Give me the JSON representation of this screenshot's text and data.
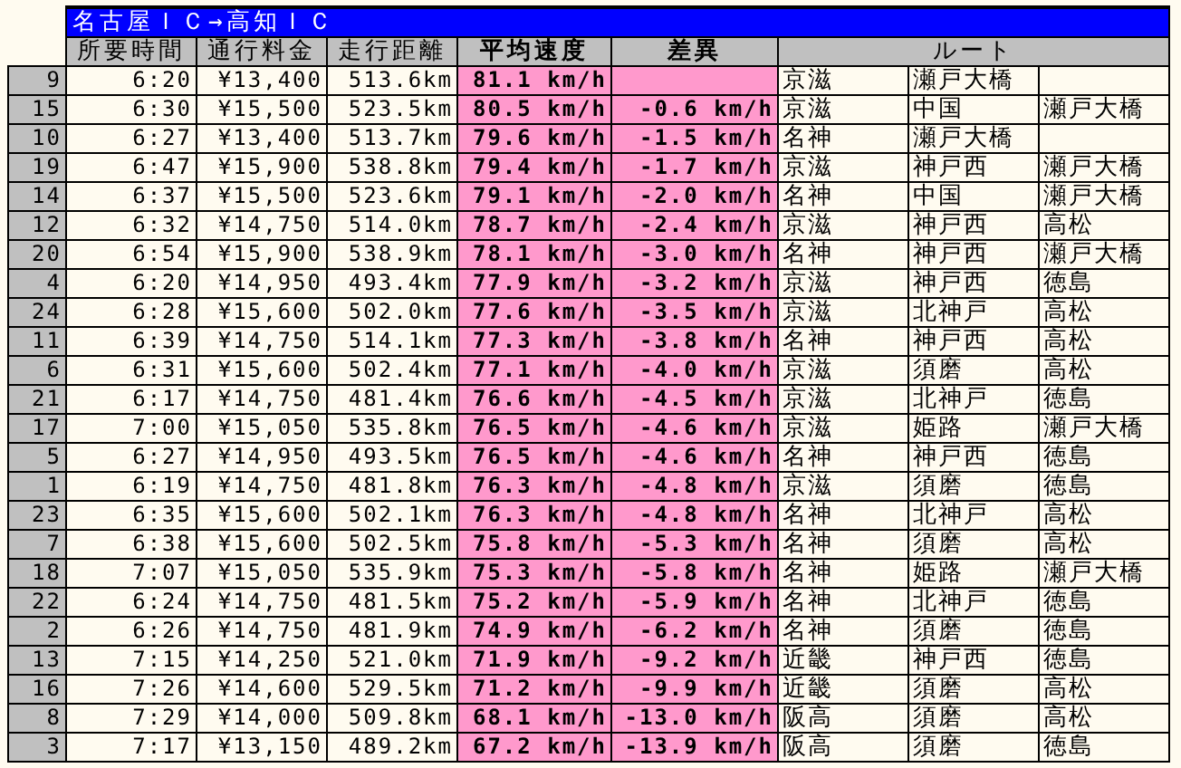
{
  "table": {
    "title": "名古屋ＩＣ→高知ＩＣ",
    "columns": [
      {
        "label": "所要時間",
        "bold": false
      },
      {
        "label": "通行料金",
        "bold": false
      },
      {
        "label": "走行距離",
        "bold": false
      },
      {
        "label": "平均速度",
        "bold": true
      },
      {
        "label": "差異",
        "bold": true
      },
      {
        "label": "ルート",
        "bold": false
      }
    ],
    "rows": [
      {
        "no": "9",
        "time": "6:20",
        "toll": "¥13,400",
        "distance": "513.6km",
        "speed": "81.1 km/h",
        "route": [
          "京滋",
          "瀬戸大橋"
        ]
      },
      {
        "no": "15",
        "time": "6:30",
        "toll": "¥15,500",
        "distance": "523.5km",
        "speed": "80.5 km/h",
        "difference": "-0.6 km/h",
        "route": [
          "京滋",
          "中国",
          "瀬戸大橋"
        ]
      },
      {
        "no": "10",
        "time": "6:27",
        "toll": "¥13,400",
        "distance": "513.7km",
        "speed": "79.6 km/h",
        "difference": "-1.5 km/h",
        "route": [
          "名神",
          "瀬戸大橋"
        ]
      },
      {
        "no": "19",
        "time": "6:47",
        "toll": "¥15,900",
        "distance": "538.8km",
        "speed": "79.4 km/h",
        "difference": "-1.7 km/h",
        "route": [
          "京滋",
          "神戸西",
          "瀬戸大橋"
        ]
      },
      {
        "no": "14",
        "time": "6:37",
        "toll": "¥15,500",
        "distance": "523.6km",
        "speed": "79.1 km/h",
        "difference": "-2.0 km/h",
        "route": [
          "名神",
          "中国",
          "瀬戸大橋"
        ]
      },
      {
        "no": "12",
        "time": "6:32",
        "toll": "¥14,750",
        "distance": "514.0km",
        "speed": "78.7 km/h",
        "difference": "-2.4 km/h",
        "route": [
          "京滋",
          "神戸西",
          "高松"
        ]
      },
      {
        "no": "20",
        "time": "6:54",
        "toll": "¥15,900",
        "distance": "538.9km",
        "speed": "78.1 km/h",
        "difference": "-3.0 km/h",
        "route": [
          "名神",
          "神戸西",
          "瀬戸大橋"
        ]
      },
      {
        "no": "4",
        "time": "6:20",
        "toll": "¥14,950",
        "distance": "493.4km",
        "speed": "77.9 km/h",
        "difference": "-3.2 km/h",
        "route": [
          "京滋",
          "神戸西",
          "徳島"
        ]
      },
      {
        "no": "24",
        "time": "6:28",
        "toll": "¥15,600",
        "distance": "502.0km",
        "speed": "77.6 km/h",
        "difference": "-3.5 km/h",
        "route": [
          "京滋",
          "北神戸",
          "高松"
        ]
      },
      {
        "no": "11",
        "time": "6:39",
        "toll": "¥14,750",
        "distance": "514.1km",
        "speed": "77.3 km/h",
        "difference": "-3.8 km/h",
        "route": [
          "名神",
          "神戸西",
          "高松"
        ]
      },
      {
        "no": "6",
        "time": "6:31",
        "toll": "¥15,600",
        "distance": "502.4km",
        "speed": "77.1 km/h",
        "difference": "-4.0 km/h",
        "route": [
          "京滋",
          "須磨",
          "高松"
        ]
      },
      {
        "no": "21",
        "time": "6:17",
        "toll": "¥14,750",
        "distance": "481.4km",
        "speed": "76.6 km/h",
        "difference": "-4.5 km/h",
        "route": [
          "京滋",
          "北神戸",
          "徳島"
        ]
      },
      {
        "no": "17",
        "time": "7:00",
        "toll": "¥15,050",
        "distance": "535.8km",
        "speed": "76.5 km/h",
        "difference": "-4.6 km/h",
        "route": [
          "京滋",
          "姫路",
          "瀬戸大橋"
        ]
      },
      {
        "no": "5",
        "time": "6:27",
        "toll": "¥14,950",
        "distance": "493.5km",
        "speed": "76.5 km/h",
        "difference": "-4.6 km/h",
        "route": [
          "名神",
          "神戸西",
          "徳島"
        ]
      },
      {
        "no": "1",
        "time": "6:19",
        "toll": "¥14,750",
        "distance": "481.8km",
        "speed": "76.3 km/h",
        "difference": "-4.8 km/h",
        "route": [
          "京滋",
          "須磨",
          "徳島"
        ]
      },
      {
        "no": "23",
        "time": "6:35",
        "toll": "¥15,600",
        "distance": "502.1km",
        "speed": "76.3 km/h",
        "difference": "-4.8 km/h",
        "route": [
          "名神",
          "北神戸",
          "高松"
        ]
      },
      {
        "no": "7",
        "time": "6:38",
        "toll": "¥15,600",
        "distance": "502.5km",
        "speed": "75.8 km/h",
        "difference": "-5.3 km/h",
        "route": [
          "名神",
          "須磨",
          "高松"
        ]
      },
      {
        "no": "18",
        "time": "7:07",
        "toll": "¥15,050",
        "distance": "535.9km",
        "speed": "75.3 km/h",
        "difference": "-5.8 km/h",
        "route": [
          "名神",
          "姫路",
          "瀬戸大橋"
        ]
      },
      {
        "no": "22",
        "time": "6:24",
        "toll": "¥14,750",
        "distance": "481.5km",
        "speed": "75.2 km/h",
        "difference": "-5.9 km/h",
        "route": [
          "名神",
          "北神戸",
          "徳島"
        ]
      },
      {
        "no": "2",
        "time": "6:26",
        "toll": "¥14,750",
        "distance": "481.9km",
        "speed": "74.9 km/h",
        "difference": "-6.2 km/h",
        "route": [
          "名神",
          "須磨",
          "徳島"
        ]
      },
      {
        "no": "13",
        "time": "7:15",
        "toll": "¥14,250",
        "distance": "521.0km",
        "speed": "71.9 km/h",
        "difference": "-9.2 km/h",
        "route": [
          "近畿",
          "神戸西",
          "徳島"
        ]
      },
      {
        "no": "16",
        "time": "7:26",
        "toll": "¥14,600",
        "distance": "529.5km",
        "speed": "71.2 km/h",
        "difference": "-9.9 km/h",
        "route": [
          "近畿",
          "須磨",
          "高松"
        ]
      },
      {
        "no": "8",
        "time": "7:29",
        "toll": "¥14,000",
        "distance": "509.8km",
        "speed": "68.1 km/h",
        "difference": "-13.0 km/h",
        "route": [
          "阪高",
          "須磨",
          "高松"
        ]
      },
      {
        "no": "3",
        "time": "7:17",
        "toll": "¥13,150",
        "distance": "489.2km",
        "speed": "67.2 km/h",
        "difference": "-13.9 km/h",
        "route": [
          "阪高",
          "須磨",
          "徳島"
        ]
      }
    ]
  }
}
